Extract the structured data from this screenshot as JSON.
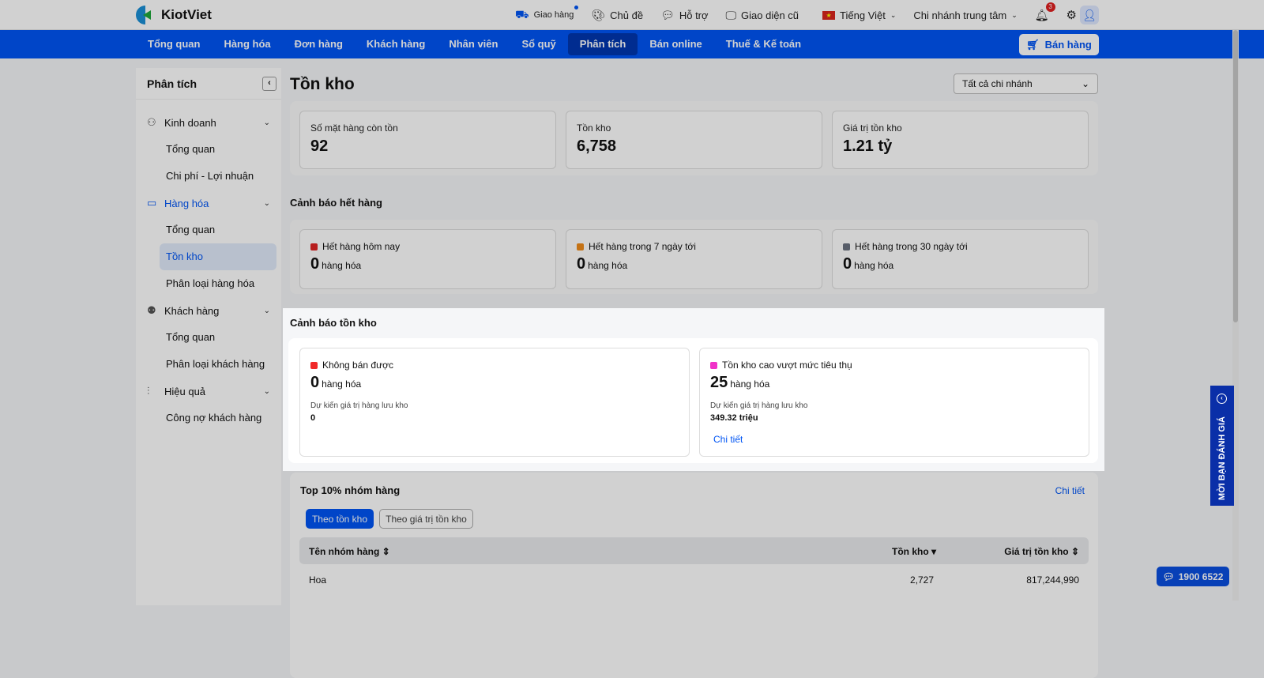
{
  "app": {
    "name": "KiotViet"
  },
  "topbar": {
    "delivery": "Giao hàng",
    "theme": "Chủ đề",
    "support": "Hỗ trợ",
    "old_ui": "Giao diện cũ",
    "language": "Tiếng Việt",
    "branch": "Chi nhánh trung tâm",
    "notifications": "3"
  },
  "nav": {
    "items": [
      "Tổng quan",
      "Hàng hóa",
      "Đơn hàng",
      "Khách hàng",
      "Nhân viên",
      "Sổ quỹ",
      "Phân tích",
      "Bán online",
      "Thuế & Kế toán"
    ],
    "active": "Phân tích",
    "sell": "Bán hàng"
  },
  "sidebar": {
    "title": "Phân tích",
    "groups": [
      {
        "label": "Kinh doanh",
        "subs": [
          "Tổng quan",
          "Chi phí - Lợi nhuận"
        ]
      },
      {
        "label": "Hàng hóa",
        "subs": [
          "Tổng quan",
          "Tồn kho",
          "Phân loại hàng hóa"
        ]
      },
      {
        "label": "Khách hàng",
        "subs": [
          "Tổng quan",
          "Phân loại khách hàng"
        ]
      },
      {
        "label": "Hiệu quả",
        "subs": [
          "Công nợ khách hàng"
        ]
      }
    ]
  },
  "main": {
    "title": "Tồn kho",
    "branch_select": "Tất cả chi nhánh",
    "summary": [
      {
        "label": "Số mặt hàng còn tồn",
        "value": "92"
      },
      {
        "label": "Tồn kho",
        "value": "6,758"
      },
      {
        "label": "Giá trị tồn kho",
        "value": "1.21 tỷ"
      }
    ],
    "out_title": "Cảnh báo hết hàng",
    "out": [
      {
        "label": "Hết hàng hôm nay",
        "value": "0",
        "unit": "hàng hóa",
        "color": "#e02424"
      },
      {
        "label": "Hết hàng trong 7 ngày tới",
        "value": "0",
        "unit": "hàng hóa",
        "color": "#f08c1a"
      },
      {
        "label": "Hết hàng trong 30 ngày tới",
        "value": "0",
        "unit": "hàng hóa",
        "color": "#6b7280"
      }
    ],
    "stock_title": "Cảnh báo tồn kho",
    "stock": [
      {
        "label": "Không bán được",
        "value": "0",
        "unit": "hàng hóa",
        "sub": "Dự kiến giá trị hàng lưu kho",
        "subval": "0",
        "color": "#f02a2a"
      },
      {
        "label": "Tồn kho cao vượt mức tiêu thụ",
        "value": "25",
        "unit": "hàng hóa",
        "sub": "Dự kiến giá trị hàng lưu kho",
        "subval": "349.32 triệu",
        "link": "Chi tiết",
        "color": "#f032c8"
      }
    ],
    "top": {
      "title": "Top 10% nhóm hàng",
      "link": "Chi tiết",
      "tabs": [
        "Theo tồn kho",
        "Theo giá trị tồn kho"
      ],
      "columns": [
        "Tên nhóm hàng",
        "Tồn kho",
        "Giá trị tồn kho"
      ],
      "rows": [
        [
          "Hoa",
          "2,727",
          "817,244,990"
        ]
      ]
    }
  },
  "float": {
    "rate": "MỜI BẠN ĐÁNH GIÁ",
    "hotline": "1900 6522"
  }
}
